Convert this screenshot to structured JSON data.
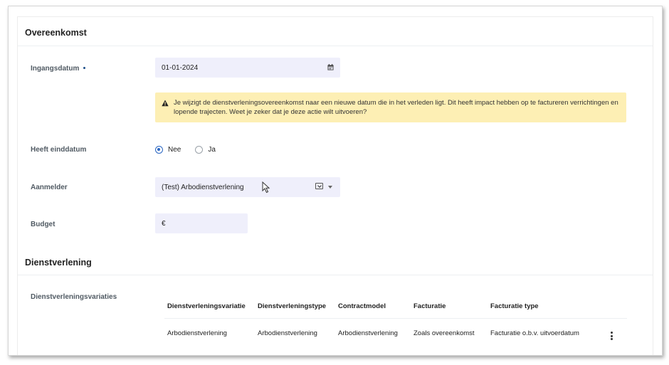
{
  "overeenkomst": {
    "title": "Overeenkomst",
    "ingangsdatum": {
      "label": "Ingangsdatum",
      "value": "01-01-2024"
    },
    "warning": {
      "text": "Je wijzigt de dienstverleningsovereenkomst naar een nieuwe datum die in het verleden ligt. Dit heeft impact hebben op te factureren verrichtingen en lopende trajecten. Weet je zeker dat je deze actie wilt uitvoeren?"
    },
    "heeft_einddatum": {
      "label": "Heeft einddatum",
      "options": [
        {
          "label": "Nee",
          "checked": true
        },
        {
          "label": "Ja",
          "checked": false
        }
      ]
    },
    "aanmelder": {
      "label": "Aanmelder",
      "value": "(Test) Arbodienstverlening"
    },
    "budget": {
      "label": "Budget",
      "currency": "€"
    }
  },
  "dienstverlening": {
    "title": "Dienstverlening",
    "variaties_label": "Dienstverleningsvariaties",
    "table": {
      "headers": [
        "Dienstverleningsvariatie",
        "Dienstverleningstype",
        "Contractmodel",
        "Facturatie",
        "Facturatie type"
      ],
      "rows": [
        [
          "Arbodienstverlening",
          "Arbodienstverlening",
          "Arbodienstverlening",
          "Zoals overeenkomst",
          "Facturatie o.b.v. uitvoerdatum"
        ]
      ]
    }
  },
  "colors": {
    "field_bg": "#efeffb",
    "warning_bg": "#fdefb4",
    "accent": "#2a66c2"
  }
}
